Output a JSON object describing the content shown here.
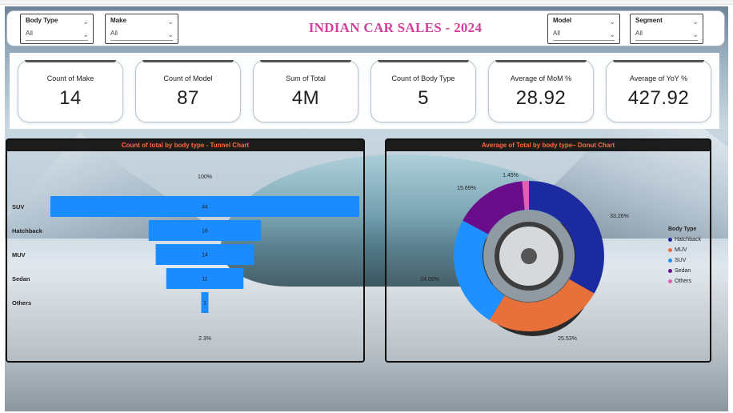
{
  "header": {
    "title": "INDIAN CAR SALES - 2024",
    "slicers": {
      "body_type": {
        "title": "Body Type",
        "value": "All"
      },
      "make": {
        "title": "Make",
        "value": "All"
      },
      "model": {
        "title": "Model",
        "value": "All"
      },
      "segment": {
        "title": "Segment",
        "value": "All"
      }
    }
  },
  "kpis": {
    "make": {
      "label": "Count of Make",
      "value": "14"
    },
    "model": {
      "label": "Count of Model",
      "value": "87"
    },
    "total": {
      "label": "Sum of Total",
      "value": "4M"
    },
    "body_type": {
      "label": "Count of Body Type",
      "value": "5"
    },
    "mom": {
      "label": "Average of MoM %",
      "value": "28.92"
    },
    "yoy": {
      "label": "Average of YoY %",
      "value": "427.92"
    }
  },
  "tunnel": {
    "title": "Count of total by body type - Tunnel Chart",
    "top_label": "100%",
    "bottom_label": "2.3%"
  },
  "donut": {
    "title": "Average of Total by body type– Donut Chart",
    "legend_title": "Body Type"
  },
  "colors": {
    "bar": "#1a8cff",
    "hatchback": "#1b2a9e",
    "muv": "#e8703a",
    "suv": "#1e90ff",
    "sedan": "#6a0d8a",
    "others": "#e35db7",
    "title_pink": "#d43f9e",
    "panel_title": "#ff6a3c"
  },
  "chart_data": [
    {
      "type": "bar",
      "title": "Count of total by body type - Tunnel Chart",
      "categories": [
        "SUV",
        "Hatchback",
        "MUV",
        "Sedan",
        "Others"
      ],
      "values": [
        44,
        16,
        14,
        11,
        1
      ]
    },
    {
      "type": "pie",
      "title": "Average of Total by body type– Donut Chart",
      "legend_title": "Body Type",
      "categories": [
        "Hatchback",
        "MUV",
        "SUV",
        "Sedan",
        "Others"
      ],
      "values": [
        33.26,
        25.53,
        24.06,
        15.69,
        1.45
      ],
      "labels": [
        "33.26%",
        "25.53%",
        "24.06%",
        "15.69%",
        "1.45%"
      ]
    }
  ]
}
